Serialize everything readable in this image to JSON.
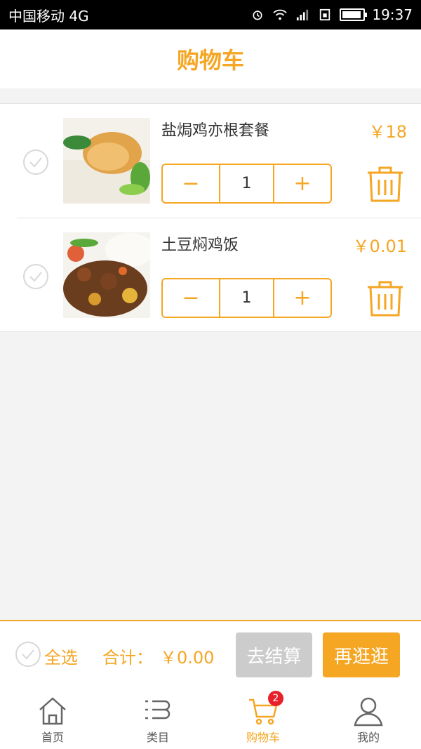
{
  "status_bar": {
    "carrier": "中国移动 4G",
    "time": "19:37",
    "icons": [
      "alarm-icon",
      "wifi-icon",
      "signal-icon",
      "sim-icon",
      "battery-icon"
    ]
  },
  "header": {
    "title": "购物车"
  },
  "cart": {
    "items": [
      {
        "name": "盐焗鸡亦根套餐",
        "price": "￥18",
        "quantity": "1",
        "minus": "−",
        "plus": "+"
      },
      {
        "name": "土豆焖鸡饭",
        "price": "￥0.01",
        "quantity": "1",
        "minus": "−",
        "plus": "+"
      }
    ]
  },
  "footer": {
    "select_all": "全选",
    "total_label": "合计：",
    "total_value": "￥0.00",
    "checkout": "去结算",
    "continue": "再逛逛"
  },
  "tabbar": {
    "tabs": [
      {
        "label": "首页",
        "icon": "home-icon"
      },
      {
        "label": "类目",
        "icon": "category-icon"
      },
      {
        "label": "购物车",
        "icon": "cart-icon",
        "badge": "2"
      },
      {
        "label": "我的",
        "icon": "profile-icon"
      }
    ]
  },
  "colors": {
    "accent": "#f5a623",
    "disabled": "#cccccc",
    "badge": "#e8202a"
  }
}
